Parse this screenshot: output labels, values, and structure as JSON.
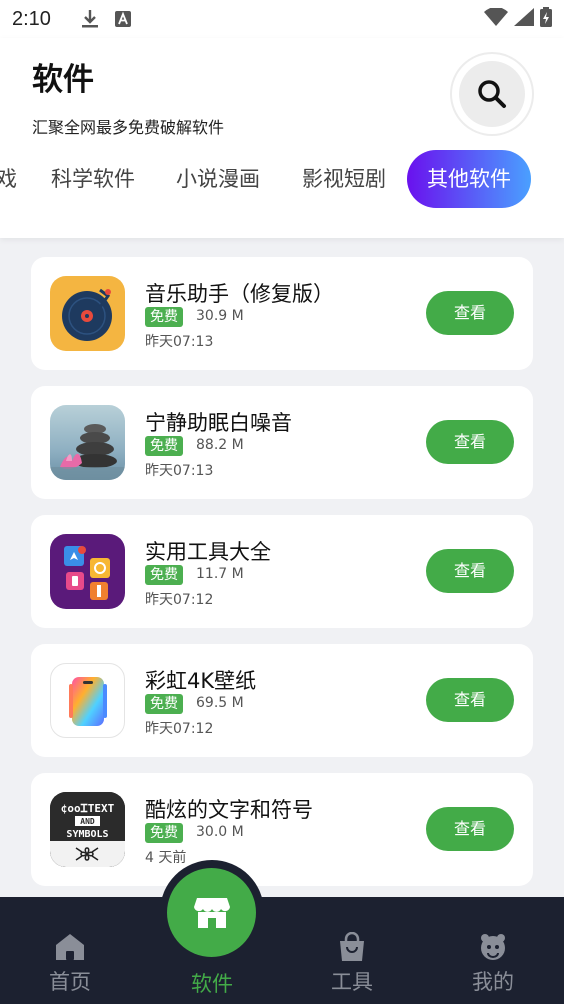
{
  "status_bar": {
    "time": "2:10",
    "icons": [
      "download-icon",
      "font-icon",
      "wifi-icon",
      "signal-icon",
      "battery-charging-icon"
    ]
  },
  "header": {
    "title": "软件",
    "subtitle": "汇聚全网最多免费破解软件",
    "search_icon": "search-icon"
  },
  "tabs": [
    {
      "label": "戏",
      "active": false
    },
    {
      "label": "科学软件",
      "active": false
    },
    {
      "label": "小说漫画",
      "active": false
    },
    {
      "label": "影视短剧",
      "active": false
    },
    {
      "label": "其他软件",
      "active": true
    }
  ],
  "colors": {
    "accent_green": "#43ab48",
    "tab_gradient_start": "#6a11ee",
    "tab_gradient_end": "#4aa0ff",
    "nav_background": "#1c2130"
  },
  "apps": [
    {
      "name": "音乐助手（修复版）",
      "badge": "免费",
      "size": "30.9 M",
      "time": "昨天07:13",
      "button": "查看",
      "icon": "music-disc-icon"
    },
    {
      "name": "宁静助眠白噪音",
      "badge": "免费",
      "size": "88.2 M",
      "time": "昨天07:13",
      "button": "查看",
      "icon": "zen-stones-icon"
    },
    {
      "name": "实用工具大全",
      "badge": "免费",
      "size": "11.7 M",
      "time": "昨天07:12",
      "button": "查看",
      "icon": "toolbox-icon"
    },
    {
      "name": "彩虹4K壁纸",
      "badge": "免费",
      "size": "69.5 M",
      "time": "昨天07:12",
      "button": "查看",
      "icon": "rainbow-phone-icon"
    },
    {
      "name": "酷炫的文字和符号",
      "badge": "免费",
      "size": "30.0 M",
      "time": "4 天前",
      "button": "查看",
      "icon": "cool-text-icon",
      "icon_text": [
        "¢ooᏆTEXT",
        "AND",
        "SYMBOLS"
      ]
    }
  ],
  "bottom_nav": [
    {
      "label": "首页",
      "icon": "home-icon",
      "active": false
    },
    {
      "label": "软件",
      "icon": "store-icon",
      "active": true
    },
    {
      "label": "工具",
      "icon": "bag-icon",
      "active": false
    },
    {
      "label": "我的",
      "icon": "profile-icon",
      "active": false
    }
  ]
}
